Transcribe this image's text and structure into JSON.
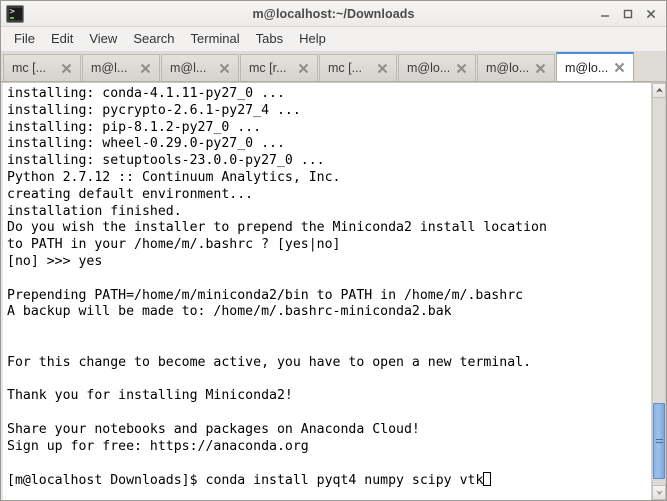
{
  "window": {
    "title": "m@localhost:~/Downloads",
    "app_icon": "terminal-icon",
    "controls": {
      "minimize": "minimize-icon",
      "maximize": "maximize-icon",
      "close": "close-icon"
    }
  },
  "menubar": {
    "items": [
      {
        "label": "File"
      },
      {
        "label": "Edit"
      },
      {
        "label": "View"
      },
      {
        "label": "Search"
      },
      {
        "label": "Terminal"
      },
      {
        "label": "Tabs"
      },
      {
        "label": "Help"
      }
    ]
  },
  "tabs": [
    {
      "label": "mc [...",
      "active": false
    },
    {
      "label": "m@l...",
      "active": false
    },
    {
      "label": "m@l...",
      "active": false
    },
    {
      "label": "mc [r...",
      "active": false
    },
    {
      "label": "mc [...",
      "active": false
    },
    {
      "label": "m@lo...",
      "active": false
    },
    {
      "label": "m@lo...",
      "active": false
    },
    {
      "label": "m@lo...",
      "active": true
    }
  ],
  "terminal": {
    "lines": [
      "installing: conda-4.1.11-py27_0 ...",
      "installing: pycrypto-2.6.1-py27_4 ...",
      "installing: pip-8.1.2-py27_0 ...",
      "installing: wheel-0.29.0-py27_0 ...",
      "installing: setuptools-23.0.0-py27_0 ...",
      "Python 2.7.12 :: Continuum Analytics, Inc.",
      "creating default environment...",
      "installation finished.",
      "Do you wish the installer to prepend the Miniconda2 install location",
      "to PATH in your /home/m/.bashrc ? [yes|no]",
      "[no] >>> yes",
      "",
      "Prepending PATH=/home/m/miniconda2/bin to PATH in /home/m/.bashrc",
      "A backup will be made to: /home/m/.bashrc-miniconda2.bak",
      "",
      "",
      "For this change to become active, you have to open a new terminal.",
      "",
      "Thank you for installing Miniconda2!",
      "",
      "Share your notebooks and packages on Anaconda Cloud!",
      "Sign up for free: https://anaconda.org",
      ""
    ],
    "prompt": "[m@localhost Downloads]$ ",
    "command": "conda install pyqt4 numpy scipy vtk",
    "cursor": "block-cursor"
  },
  "scrollbar": {
    "up_arrow": "scroll-up-icon",
    "down_arrow": "scroll-down-icon",
    "thumb": "scroll-thumb"
  },
  "colors": {
    "titlebar_bg": "#f2f1f0",
    "tabbar_bg": "#dfdcd8",
    "active_tab_accent": "#4a90d9",
    "terminal_bg": "#ffffff",
    "terminal_fg": "#000000",
    "scroll_thumb": "#8fb5e4"
  }
}
